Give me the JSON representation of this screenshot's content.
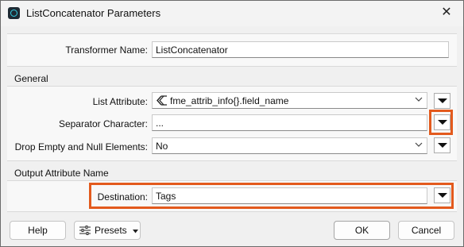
{
  "window": {
    "title": "ListConcatenator Parameters",
    "close_glyph": "✕"
  },
  "transformer": {
    "label": "Transformer Name:",
    "value": "ListConcatenator"
  },
  "general": {
    "group_label": "General",
    "list_attribute": {
      "label": "List Attribute:",
      "value": "fme_attrib_info{}.field_name",
      "icon": "list-attribute-icon"
    },
    "separator": {
      "label": "Separator Character:",
      "value": "..."
    },
    "drop_empty": {
      "label": "Drop Empty and Null Elements:",
      "value": "No"
    }
  },
  "output": {
    "group_label": "Output Attribute Name",
    "destination": {
      "label": "Destination:",
      "value": "Tags"
    }
  },
  "buttons": {
    "help": "Help",
    "presets": "Presets",
    "ok": "OK",
    "cancel": "Cancel"
  },
  "colors": {
    "highlight": "#e35a1d",
    "icon_ring": "#34d0e6"
  }
}
